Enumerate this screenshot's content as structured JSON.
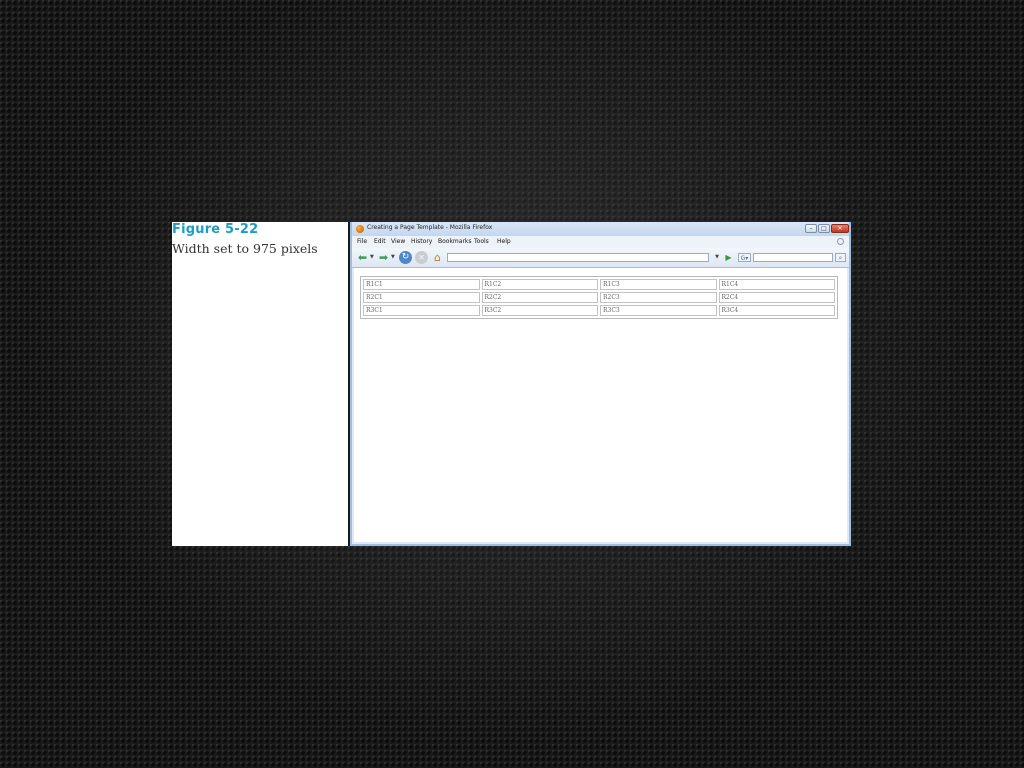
{
  "caption": {
    "figure_label": "Figure 5-22",
    "text": "Width set to 975 pixels"
  },
  "window": {
    "title": "Creating a Page Template - Mozilla Firefox"
  },
  "menu": [
    "File",
    "Edit",
    "View",
    "History",
    "Bookmarks",
    "Tools",
    "Help"
  ],
  "toolbar": {
    "url_value": "",
    "search_value": ""
  },
  "table": {
    "rows": [
      [
        "R1C1",
        "R1C2",
        "R1C3",
        "R1C4"
      ],
      [
        "R2C1",
        "R2C2",
        "R2C3",
        "R2C4"
      ],
      [
        "R3C1",
        "R3C2",
        "R3C3",
        "R3C4"
      ]
    ]
  },
  "colors": {
    "figure_label": "#1e9cc4",
    "window_frame": "#9fbfe0",
    "nav_green": "#3aa052",
    "reload_blue": "#4e86c8"
  },
  "icons": {
    "back": "back-arrow-icon",
    "forward": "forward-arrow-icon",
    "reload": "reload-icon",
    "stop": "stop-icon",
    "home": "home-icon",
    "go": "go-arrow-icon",
    "search_engine": "search-engine-icon",
    "search": "search-icon"
  }
}
